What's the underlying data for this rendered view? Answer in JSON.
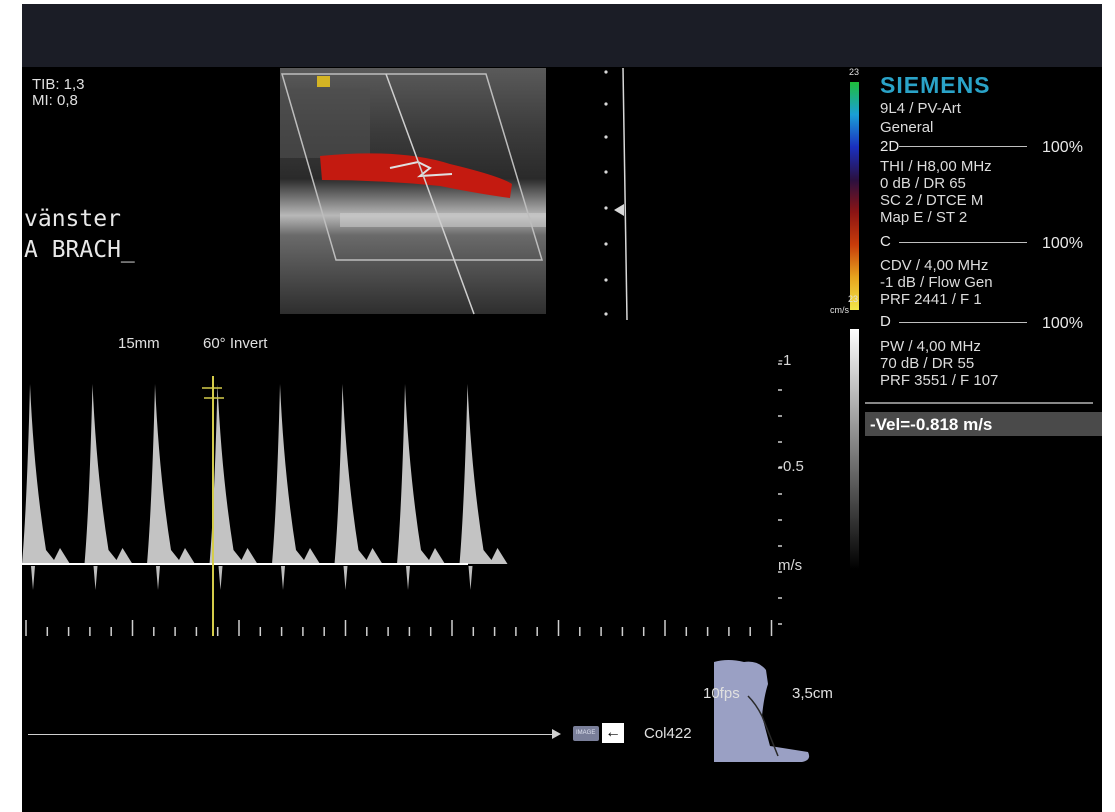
{
  "system": {
    "brand": "SIEMENS",
    "probe": "9L4 / PV-Art",
    "preset": "General"
  },
  "acoustic": {
    "tib": "TIB: 1,3",
    "mi": "MI:  0,8"
  },
  "annotation": {
    "side": "vänster",
    "vessel": "A BRACH_"
  },
  "modes": {
    "b_mode": {
      "label": "2D",
      "power": "100%",
      "params": [
        "THI / H8,00 MHz",
        "0 dB / DR 65",
        "SC 2 / DTCE M",
        "Map E / ST 2"
      ]
    },
    "color": {
      "label": "C",
      "power": "100%",
      "params": [
        "CDV / 4,00 MHz",
        "-1 dB / Flow Gen",
        "PRF 2441 / F 1"
      ]
    },
    "doppler": {
      "label": "D",
      "power": "100%",
      "params": [
        "PW / 4,00 MHz",
        "70 dB / DR 55",
        "PRF 3551 / F 107"
      ]
    }
  },
  "color_bar": {
    "top_scale": "23",
    "bottom_scale": "23",
    "unit": "cm/s",
    "colors": [
      "#1fbf3a",
      "#1a9fd6",
      "#1a2fbf",
      "#2a1040",
      "#8c1414",
      "#c83c0a",
      "#e6a51e",
      "#f2e64a"
    ]
  },
  "measurement": {
    "velocity": "-Vel=-0.818 m/s"
  },
  "spectral": {
    "gate": "15mm",
    "angle": "60°  Invert",
    "scale_labels": [
      "-1",
      "-0.5",
      "m/s"
    ],
    "peak_count": 8,
    "angle_line_color": "#d4cc4a"
  },
  "status": {
    "frame_rate": "10fps",
    "depth": "3,5cm",
    "colormap": "Col422",
    "icon_text": "IMAGE",
    "arrow": "←"
  }
}
